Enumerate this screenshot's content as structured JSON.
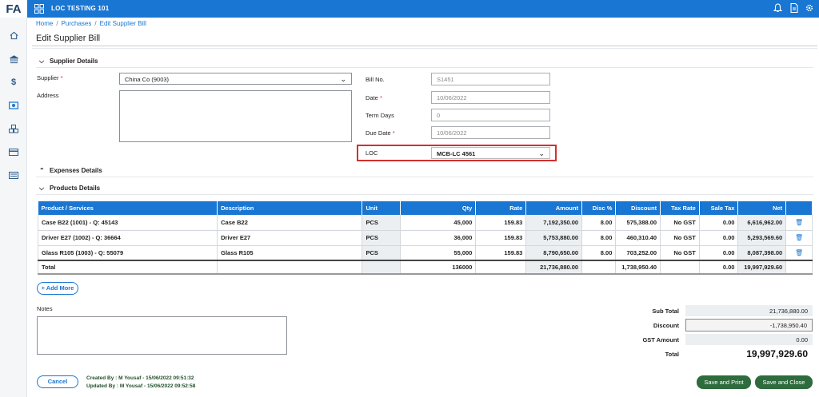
{
  "app": {
    "logo": "FA",
    "company": "LOC TESTING 101"
  },
  "sidebar": {
    "icons": [
      "home-icon",
      "bank-icon",
      "dollar-icon",
      "cash-icon",
      "stock-icon",
      "card-icon",
      "report-icon"
    ]
  },
  "topbar": {
    "icons": [
      "bell-icon",
      "document-icon",
      "gear-icon"
    ]
  },
  "breadcrumb": {
    "home": "Home",
    "purchases": "Purchases",
    "current": "Edit Supplier Bill"
  },
  "page": {
    "title": "Edit Supplier Bill"
  },
  "sections": {
    "supplier": "Supplier Details",
    "expenses": "Expenses Details",
    "products": "Products Details"
  },
  "form": {
    "supplier_label": "Supplier",
    "supplier_value": "China Co (9003)",
    "address_label": "Address",
    "bill_no_label": "Bill No.",
    "bill_no_value": "S1451",
    "date_label": "Date",
    "date_value": "10/06/2022",
    "term_days_label": "Term Days",
    "term_days_value": "0",
    "due_date_label": "Due Date",
    "due_date_value": "10/06/2022",
    "loc_label": "LOC",
    "loc_value": "MCB-LC 4561",
    "required_mark": "*"
  },
  "table": {
    "headers": [
      "Product / Services",
      "Description",
      "Unit",
      "Qty",
      "Rate",
      "Amount",
      "Disc %",
      "Discount",
      "Tax Rate",
      "Sale Tax",
      "Net"
    ],
    "rows": [
      {
        "product": "Case B22 (1001) - Q: 45143",
        "description": "Case B22",
        "unit": "PCS",
        "qty": "45,000",
        "rate": "159.83",
        "amount": "7,192,350.00",
        "disc": "8.00",
        "discount": "575,388.00",
        "tax_rate": "No GST",
        "sale_tax": "0.00",
        "net": "6,616,962.00"
      },
      {
        "product": "Driver E27 (1002) - Q: 36664",
        "description": "Driver E27",
        "unit": "PCS",
        "qty": "36,000",
        "rate": "159.83",
        "amount": "5,753,880.00",
        "disc": "8.00",
        "discount": "460,310.40",
        "tax_rate": "No GST",
        "sale_tax": "0.00",
        "net": "5,293,569.60"
      },
      {
        "product": "Glass R105 (1003) - Q: 55079",
        "description": "Glass R105",
        "unit": "PCS",
        "qty": "55,000",
        "rate": "159.83",
        "amount": "8,790,650.00",
        "disc": "8.00",
        "discount": "703,252.00",
        "tax_rate": "No GST",
        "sale_tax": "0.00",
        "net": "8,087,398.00"
      }
    ],
    "total": {
      "label": "Total",
      "qty": "136000",
      "amount": "21,736,880.00",
      "discount": "1,738,950.40",
      "sale_tax": "0.00",
      "net": "19,997,929.60"
    }
  },
  "add_more": "+ Add More",
  "notes_label": "Notes",
  "summary": {
    "sub_total_label": "Sub Total",
    "sub_total": "21,736,880.00",
    "discount_label": "Discount",
    "discount": "-1,738,950.40",
    "gst_label": "GST Amount",
    "gst": "0.00",
    "total_label": "Total",
    "total": "19,997,929.60"
  },
  "footer": {
    "cancel": "Cancel",
    "created_by": "Created By : M Yousaf - 15/06/2022 09:51:32",
    "updated_by": "Updated By : M Yousaf - 15/06/2022 09:52:58",
    "save_print": "Save and Print",
    "save_close": "Save and Close"
  },
  "colors": {
    "primary": "#1976d2",
    "green": "#2e6b3d",
    "highlight": "#d32f2f"
  }
}
